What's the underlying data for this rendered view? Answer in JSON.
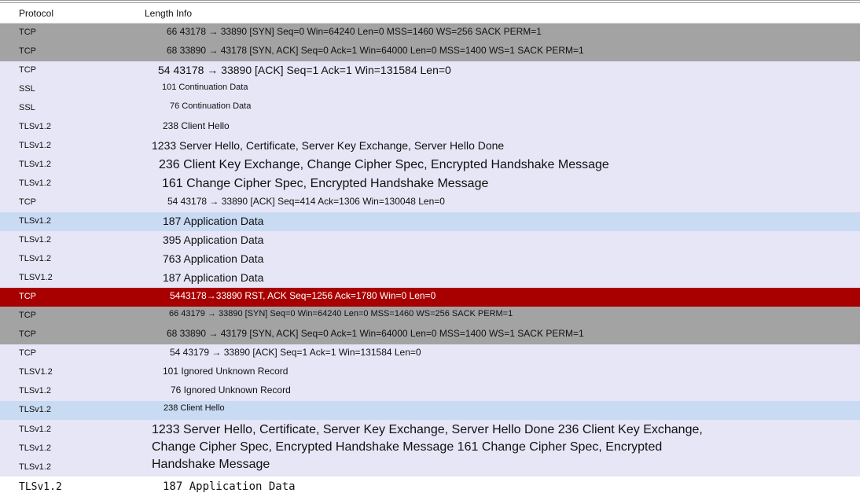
{
  "header": {
    "protocol": "Protocol",
    "length_info": "Length Info"
  },
  "colors": {
    "gray": "#a3a3a3",
    "blue": "#c9daf3",
    "red": "#a80000",
    "default": "#e6e6f7"
  },
  "rows": [
    {
      "protocol": "TCP",
      "info": "66 43178 → 33890 [SYN] Seq=0 Win=64240 Len=0 MSS=1460 WS=256 SACK PERM=1"
    },
    {
      "protocol": "TCP",
      "info": "68 33890 → 43178 [SYN, ACK] Seq=0 Ack=1 Win=64000 Len=0 MSS=1400 WS=1 SACK PERM=1"
    },
    {
      "protocol": "TCP",
      "info": "54 43178 → 33890 [ACK] Seq=1 Ack=1 Win=131584 Len=0"
    },
    {
      "protocol": "SSL",
      "info": "101 Continuation Data"
    },
    {
      "protocol": "SSL",
      "info": "76 Continuation Data"
    },
    {
      "protocol": "TLSv1.2",
      "info": "238 Client Hello"
    },
    {
      "protocol": "TLSv1.2",
      "info": "1233 Server Hello,  Certificate, Server Key Exchange, Server Hello Done"
    },
    {
      "protocol": "TLSv1.2",
      "info": "236 Client Key Exchange,  Change Cipher Spec, Encrypted Handshake Message"
    },
    {
      "protocol": "TLSv1.2",
      "info": "161 Change Cipher Spec,  Encrypted Handshake Message"
    },
    {
      "protocol": "TCP",
      "info": "54 43178 → 33890 [ACK] Seq=414 Ack=1306 Win=130048 Len=0"
    },
    {
      "protocol": "TLSv1.2",
      "info": "187 Application Data"
    },
    {
      "protocol": "TLSv1.2",
      "info": "395 Application Data"
    },
    {
      "protocol": "TLSv1.2",
      "info": "763 Application Data"
    },
    {
      "protocol": "TLSV1.2",
      "info": "187 Application Data"
    },
    {
      "protocol": "TCP",
      "info": "5443178→33890 RST,  ACK Seq=1256 Ack=1780 Win=0 Len=0"
    },
    {
      "protocol": "TCP",
      "info": "66 43179 → 33890 [SYN] Seq=0 Win=64240 Len=0 MSS=1460 WS=256 SACK PERM=1"
    },
    {
      "protocol": "TCP",
      "info": "68 33890 → 43179 [SYN, ACK] Seq=0 Ack=1 Win=64000 Len=0 MSS=1400 WS=1 SACK PERM=1"
    },
    {
      "protocol": "TCP",
      "info": "54 43179 → 33890 [ACK] Seq=1 Ack=1 Win=131584 Len=0"
    },
    {
      "protocol": "TLSV1.2",
      "info": "101 Ignored Unknown Record"
    },
    {
      "protocol": "TLSv1.2",
      "info": "76 Ignored Unknown Record"
    },
    {
      "protocol": "TLSv1.2",
      "info": "238 Client Hello"
    },
    {
      "protocol": "TLSv1.2\nTLSv1.2\nTLSv1.2",
      "info": "1233 Server Hello,  Certificate, Server Key Exchange, Server Hello Done 236 Client Key Exchange, Change Cipher Spec, Encrypted Handshake Message 161 Change Cipher Spec, Encrypted Handshake Message"
    },
    {
      "protocol": "TLSv1.2",
      "info": "187 Application Data"
    }
  ]
}
